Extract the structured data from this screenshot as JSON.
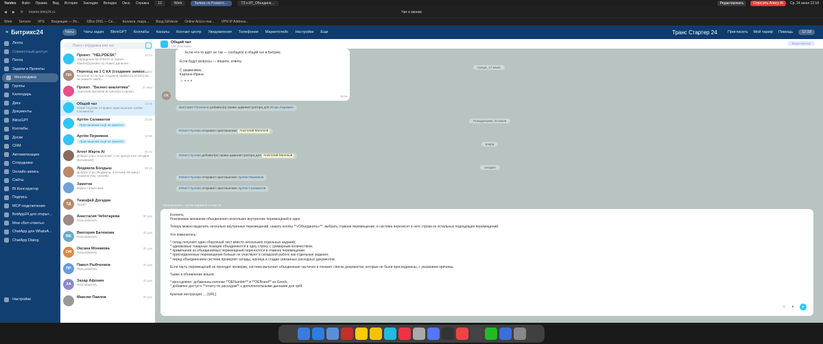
{
  "macbar": {
    "apple": "",
    "browser": "Yandex",
    "menus": [
      "Файл",
      "Правка",
      "Вид",
      "История",
      "Закладки",
      "Вкладка",
      "Окно",
      "Справка"
    ],
    "tabs_count": "12",
    "tabs": [
      "Work",
      "Заявка на Развитие ИТ",
      "ТЗ к ИТ_Объединение П"
    ],
    "edit_btn": "Редактировать",
    "alice_btn": "Спросить Алису AI",
    "datetime": "Ср, 24 июня 12:18"
  },
  "urlbar": {
    "url": "tstarter.bitrix24.ru",
    "center_title": "Чат и звонки",
    "bookmarks": [
      "Work",
      "Servers",
      "VPS",
      "Входящие — Ро...",
      "XBox DNS — Се...",
      "Коллеги, подск...",
      "Вход GitVerse",
      "Online ArUco mar...",
      "VPN IP Address..."
    ]
  },
  "leftnav": {
    "logo": "Битрикс24",
    "items": [
      {
        "label": "Лента",
        "dim": false
      },
      {
        "label": "Совместный доступ",
        "dim": true
      },
      {
        "label": "Почта",
        "dim": false
      },
      {
        "label": "Задачи и Проекты",
        "dim": false
      },
      {
        "label": "Мессенджер",
        "dim": false,
        "active": true
      },
      {
        "label": "Группы",
        "dim": false
      },
      {
        "label": "Календарь",
        "dim": false
      },
      {
        "label": "Диск",
        "dim": false
      },
      {
        "label": "Документы",
        "dim": false
      },
      {
        "label": "BitrixGPT",
        "dim": false
      },
      {
        "label": "Коллабы",
        "dim": false
      },
      {
        "label": "Доски",
        "dim": false
      },
      {
        "label": "CRM",
        "dim": false
      },
      {
        "label": "Автоматизация",
        "dim": false
      },
      {
        "label": "Сотрудники",
        "dim": false
      },
      {
        "label": "Онлайн-запись",
        "dim": false
      },
      {
        "label": "Сайты",
        "dim": false
      },
      {
        "label": "BI Конструктор",
        "dim": false
      },
      {
        "label": "Подпись",
        "dim": false
      },
      {
        "label": "MCP-подключения",
        "dim": false
      },
      {
        "label": "BotApp24 для открыт...",
        "dim": false
      },
      {
        "label": "Мои «Бот-ответы»",
        "dim": false
      },
      {
        "label": "ChatApp для WhatsA...",
        "dim": false
      },
      {
        "label": "ChatApp Dialog",
        "dim": false
      },
      {
        "label": "Настройки",
        "dim": false
      }
    ]
  },
  "topnav": {
    "tabs": [
      "Чаты",
      "Чаты задач",
      "BitrixGPT",
      "Коллабы",
      "Каналы",
      "Контакт-центр",
      "Уведомления",
      "Телефония",
      "Маркетплейс",
      "Настройки",
      "Еще"
    ],
    "brand": "Транс Стартер 24",
    "invite": "Пригласить",
    "tariff": "Мой тариф",
    "help": "Помощь",
    "time": "12:18"
  },
  "chatlist": {
    "search_placeholder": "Поиск сотрудника или чат",
    "items": [
      {
        "initials": "",
        "color": "#2fc6f6",
        "name": "Проект: \"HELPDESK\"",
        "preview": "Обращение № 479370 от tkaneт-tstarter@yandex.ru) Павел Данилин...",
        "time": "15:24"
      },
      {
        "initials": "ПН",
        "color": "#a58a7a",
        "name": "Переход на 1 С КА (создание заявок...",
        "preview": "Коллеги! Если при создании заявки на оплату вы не можете найти...",
        "time": "20 мар"
      },
      {
        "initials": "",
        "color": "#e84e8a",
        "name": "Проект: \"Бизнес-аналитика\"",
        "preview": "Анатолий Малеков вступил(а) в проект",
        "time": "21 мар"
      },
      {
        "initials": "",
        "color": "#2fc6f6",
        "name": "Общий чат",
        "preview": "Юлия Глухова отправил приглашение Артём Саламатов",
        "time": "10:05",
        "active": true
      },
      {
        "initials": "",
        "color": "#2fc6f6",
        "name": "Артём Саламатов",
        "preview": "",
        "time": "10:56",
        "badge": "Приглашение ещё не принято"
      },
      {
        "initials": "",
        "color": "#2fc6f6",
        "name": "Артём Пермяков",
        "preview": "",
        "time": "10:56",
        "badge": "Приглашение ещё не принято"
      },
      {
        "initials": "",
        "color": "#8a6a5a",
        "name": "Агент Марта AI",
        "preview": "Доброе утро, Анатолий! :) Не пропустите сегодня: (Вложения)",
        "time": "08:42"
      },
      {
        "initials": "",
        "color": "#b98a6a",
        "name": "Людмила Болдыш",
        "preview": "Доброе утро, Людмила, а почему 3D минут позвоню ему, спасибо",
        "time": "08:45"
      },
      {
        "initials": "",
        "color": "#6fa3d8",
        "name": "Заметки",
        "preview": "Видно только вам",
        "time": ""
      },
      {
        "initials": "ТД",
        "color": "#b48a6a",
        "name": "Тимофей Догадин",
        "preview": "Логист",
        "time": ""
      },
      {
        "initials": "",
        "color": "#9a8a8a",
        "name": "Анастасия Чеботарева",
        "preview": "Пользователь",
        "time": "30 дек"
      },
      {
        "initials": "ВБ",
        "color": "#6aa9c9",
        "name": "Виктория Батюкова",
        "preview": "Пользователь",
        "time": "30 дек"
      },
      {
        "initials": "ОМ",
        "color": "#d88a4a",
        "name": "Оксана Монакова",
        "preview": "Пользователь",
        "time": "30 дек"
      },
      {
        "initials": "ПР",
        "color": "#6a9ad8",
        "name": "Павел Рыбченков",
        "preview": "Пользователь",
        "time": "30 дек"
      },
      {
        "initials": "ЗА",
        "color": "#8a8aca",
        "name": "Захар Афонин",
        "preview": "Пользователь",
        "time": "30 дек"
      },
      {
        "initials": "",
        "color": "#999",
        "name": "Максим Павлов",
        "preview": "",
        "time": "30 дек"
      }
    ]
  },
  "chat": {
    "title": "Общий чат",
    "subtitle": "132 участника",
    "right_btn": "Видеозвонок",
    "card_lines": [
      "Если что-то идёт не так — сообщите в общий чат в Битрикс",
      "",
      "Если будут вопросы — пишите, отвечу.",
      "",
      "С уважением,",
      "Каргина Ирина"
    ],
    "card_avatar": "ИК",
    "card_time": "08:58",
    "dates": [
      "Среда, 17 июня",
      "Понедельник, 22 июня",
      "вчера",
      "сегодня"
    ],
    "sys1": {
      "a": "Виктория Потапина",
      "b": "добавил(а) права администратора для",
      "c": "Игорь Карамин"
    },
    "sys2": {
      "a": "Юлия Глухова",
      "b": "отправил приглашение",
      "c": "Анатолий Малеков"
    },
    "sys3": {
      "a": "Юлия Глухова",
      "b": "добавил(а) права администратора для",
      "c": "Анатолий Малеков"
    },
    "sys4": {
      "a": "Юлия Глухова",
      "b": "отправил приглашение",
      "c": "Артём Пермяков"
    },
    "sys5": {
      "a": "Юлия Глухова",
      "b": "отправил приглашение",
      "c": "Артём Саламатов"
    },
    "reply_hint": "Просмотрено: Артём Каримов и ещё 39"
  },
  "composer": {
    "lines": [
      "Коллеги,",
      "Реализован механизм объединения нескольких внутренних перемещений в одно.",
      "",
      "Теперь можно выделить несколько внутренних перемещений, нажать кнопку **«Объединить»**, выбрать главное перемещение, и система перенесет в него строки из остальных подходящих перемещений.",
      "",
      "Что изменилось:",
      "",
      "* склад получает один сборочный лист вместо нескольких отдельных заданий;",
      "* одинаковые товарные позиции объединяются в одну строку с суммарным количеством;",
      "* примечания из объединяемых перемещений переносятся в главное перемещение;",
      "* присоединенные перемещения больше не участвуют в складской работе как отдельные задания;",
      "* перед объединением система проверяет склады, юрлица и стадии связанных расходных документов.",
      "",
      "Если часть перемещений не проходит проверки, система выполнит объединение частично и покажет список документов, которые не были присоединены, с указанием причины.",
      "",
      "Также в обновление вошли:",
      "",
      "* кроссдокинг: добавлены колонки **OENumber** и **OEBrand** из Goods;",
      "* добавлен доступ к **отчету по расходам** с дополнительными данными для opt9.",
      "",
      "Краткая инструкция: ... [URL]"
    ]
  },
  "dock": {
    "colors": [
      "#3b7be0",
      "#2a7de1",
      "#5a8fd8",
      "#c4302b",
      "#ffcc00",
      "#f5c400",
      "#2bd",
      "#e34",
      "#aaa",
      "#5577ff",
      "#333",
      "#e44",
      "#444",
      "#2b2",
      "#3a6fd8",
      "#888"
    ]
  }
}
